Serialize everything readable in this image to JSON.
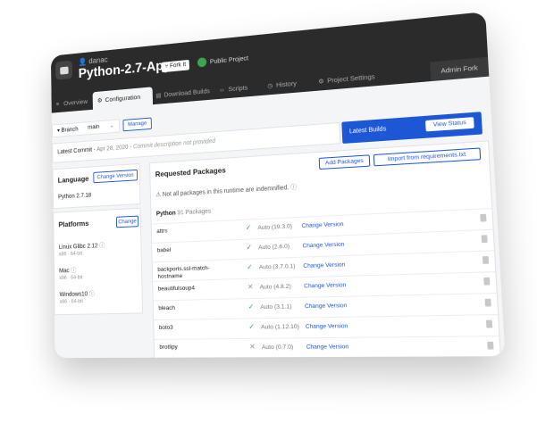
{
  "header": {
    "owner": "danac",
    "project_title": "Python-2.7-App",
    "fork_label": "Fork It",
    "visibility": "Public Project"
  },
  "tabs": [
    {
      "label": "Overview",
      "icon": "list-icon"
    },
    {
      "label": "Configuration",
      "icon": "gear-icon"
    },
    {
      "label": "Download Builds",
      "icon": "download-icon"
    },
    {
      "label": "Scripts",
      "icon": "code-icon"
    },
    {
      "label": "History",
      "icon": "clock-icon"
    },
    {
      "label": "Project Settings",
      "icon": "settings-icon"
    }
  ],
  "admin_fork": "Admin Fork",
  "branch": {
    "label": "Branch",
    "value": "main",
    "manage": "Manage"
  },
  "commit": {
    "label": "Latest Commit",
    "date": "Apr 28, 2020",
    "description": "Commit description not provided"
  },
  "latest_builds": {
    "label": "Latest Builds",
    "button": "View Status"
  },
  "language": {
    "title": "Language",
    "button": "Change Version",
    "value": "Python 2.7.18"
  },
  "platforms": {
    "title": "Platforms",
    "button": "Change",
    "items": [
      {
        "name": "Linux Glibc 2.12",
        "arch": "x86 · 64-bit"
      },
      {
        "name": "Mac",
        "arch": "x86 · 64-bit"
      },
      {
        "name": "Windows10",
        "arch": "x86 · 64-bit"
      }
    ]
  },
  "packages": {
    "title": "Requested Packages",
    "add": "Add Packages",
    "import": "Import from requirements.txt",
    "notice": "Not all packages in this runtime are indemnified.",
    "group": "Python",
    "count": "91 Packages",
    "change_label": "Change Version",
    "items": [
      {
        "name": "attrs",
        "version": "Auto (19.3.0)",
        "indemnified": true
      },
      {
        "name": "babel",
        "version": "Auto (2.6.0)",
        "indemnified": true
      },
      {
        "name": "backports.ssl-match-hostname",
        "version": "Auto (3.7.0.1)",
        "indemnified": true
      },
      {
        "name": "beautifulsoup4",
        "version": "Auto (4.8.2)",
        "indemnified": false
      },
      {
        "name": "bleach",
        "version": "Auto (3.1.1)",
        "indemnified": true
      },
      {
        "name": "boto3",
        "version": "Auto (1.12.10)",
        "indemnified": true
      },
      {
        "name": "brotlipy",
        "version": "Auto (0.7.0)",
        "indemnified": false
      }
    ]
  }
}
